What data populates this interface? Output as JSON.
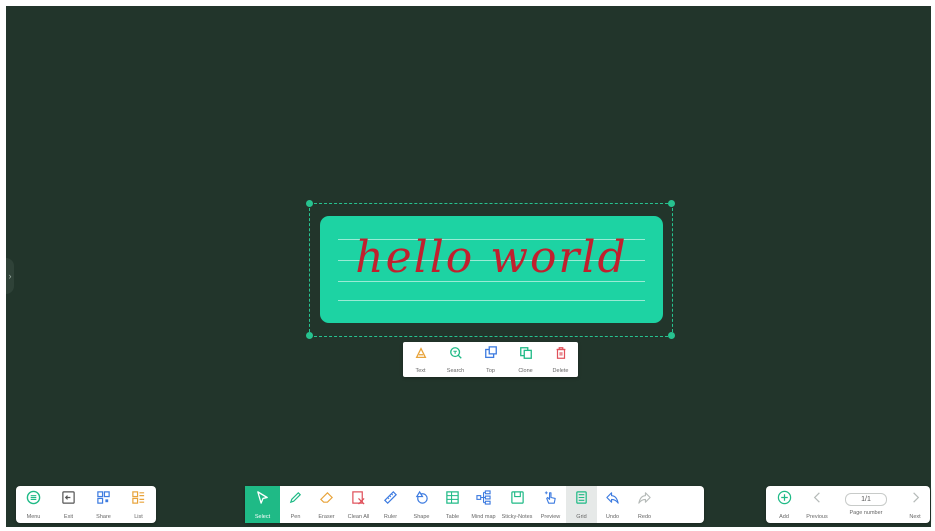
{
  "colors": {
    "board": "#22352b",
    "accent": "#1fba86",
    "card": "#1dd3a3",
    "handwriting": "#c0202e",
    "delete": "#e0505a",
    "share": "#3d7be0",
    "list": "#e8a33a"
  },
  "canvas": {
    "text": "hello world"
  },
  "context_toolbar": {
    "items": [
      {
        "label": "Text",
        "icon": "text-paint-icon"
      },
      {
        "label": "Search",
        "icon": "search-icon"
      },
      {
        "label": "Top",
        "icon": "bring-to-top-icon"
      },
      {
        "label": "Clone",
        "icon": "clone-icon"
      },
      {
        "label": "Delete",
        "icon": "trash-icon"
      }
    ]
  },
  "left_toolbar": {
    "items": [
      {
        "label": "Menu",
        "icon": "menu-icon"
      },
      {
        "label": "Exit",
        "icon": "exit-icon"
      },
      {
        "label": "Share",
        "icon": "share-qr-icon"
      },
      {
        "label": "List",
        "icon": "list-icon"
      }
    ]
  },
  "main_toolbar": {
    "active": "Select",
    "items": [
      {
        "label": "Select",
        "icon": "cursor-icon"
      },
      {
        "label": "Pen",
        "icon": "pen-icon"
      },
      {
        "label": "Eraser",
        "icon": "eraser-icon"
      },
      {
        "label": "Clean All",
        "icon": "clean-all-icon"
      },
      {
        "label": "Ruler",
        "icon": "ruler-icon"
      },
      {
        "label": "Shape",
        "icon": "shape-icon"
      },
      {
        "label": "Table",
        "icon": "table-icon"
      },
      {
        "label": "Mind map",
        "icon": "mind-map-icon"
      },
      {
        "label": "Sticky-Notes",
        "icon": "sticky-note-icon"
      },
      {
        "label": "Preview",
        "icon": "preview-hand-icon"
      },
      {
        "label": "Grid",
        "icon": "grid-icon"
      },
      {
        "label": "Undo",
        "icon": "undo-icon"
      },
      {
        "label": "Redo",
        "icon": "redo-icon"
      }
    ]
  },
  "page_toolbar": {
    "add_label": "Add",
    "previous_label": "Previous",
    "page_indicator": "1/1",
    "page_number_label": "Page number",
    "next_label": "Next"
  }
}
